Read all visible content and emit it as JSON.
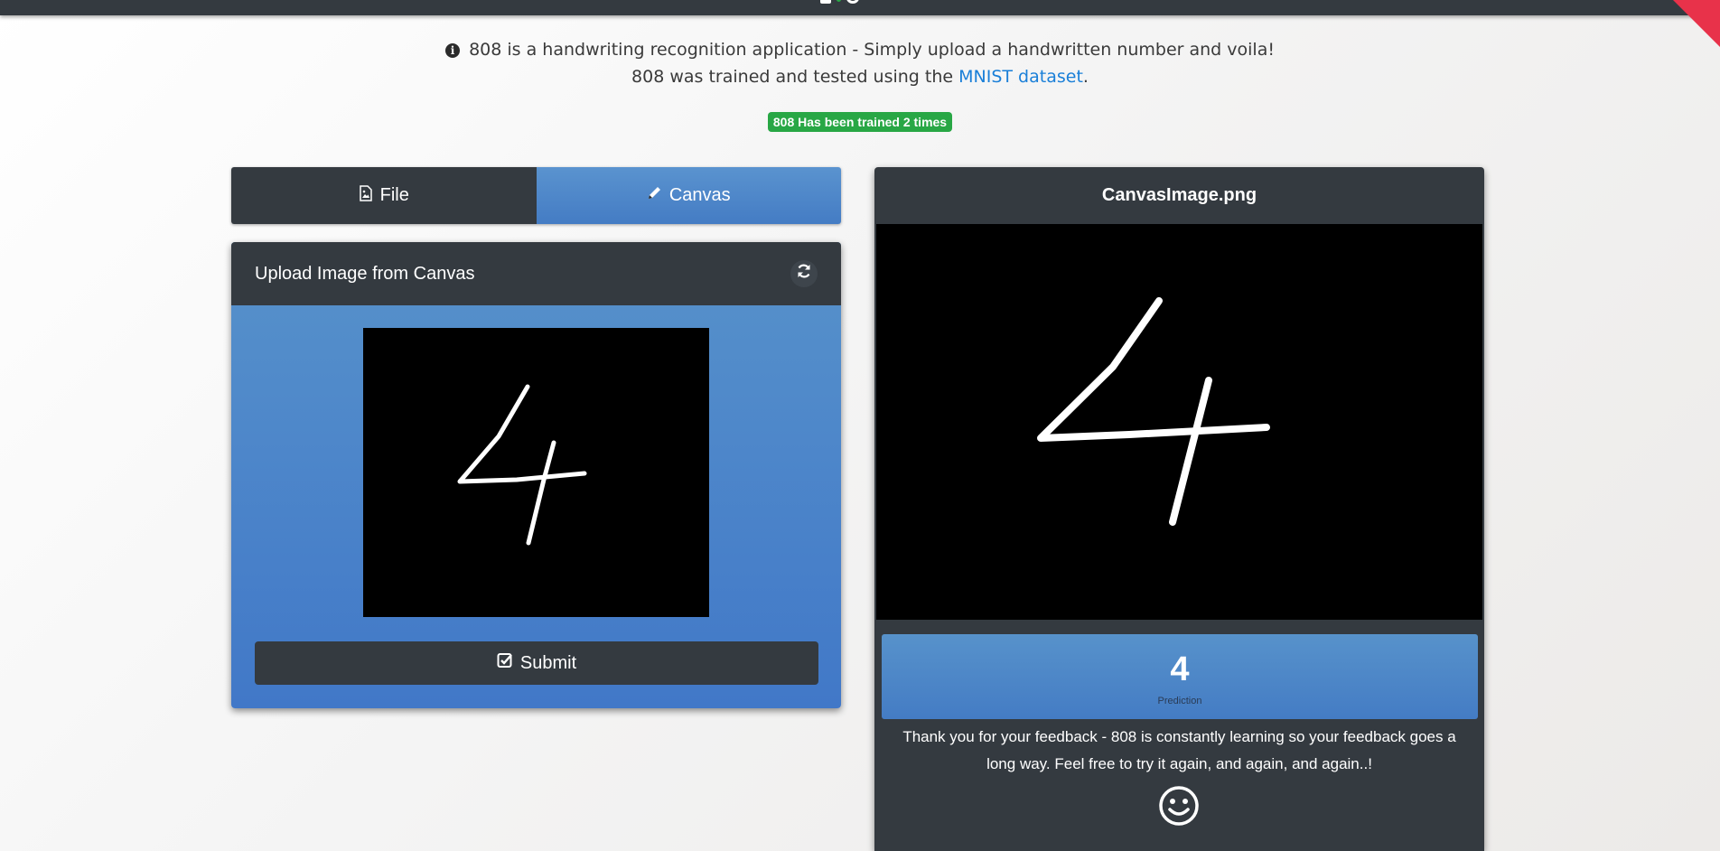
{
  "intro": {
    "line1": "808 is a handwriting recognition application - Simply upload a handwritten number and voila!",
    "line2_prefix": "808 was trained and tested using the",
    "line2_link": "MNIST dataset",
    "line2_suffix": "."
  },
  "badge": "808 Has been trained 2 times",
  "tabs": [
    {
      "label": "File",
      "icon": "image-file-icon",
      "active": false
    },
    {
      "label": "Canvas",
      "icon": "pencil-icon",
      "active": true
    }
  ],
  "upload": {
    "title": "Upload Image from Canvas",
    "refresh_icon": "refresh-icon",
    "submit_label": "Submit",
    "submit_icon": "checkbox-icon"
  },
  "result": {
    "filename": "CanvasImage.png",
    "prediction_value": "4",
    "prediction_label": "Prediction",
    "feedback": "Thank you for your feedback - 808 is constantly learning so your feedback goes a long way. Feel free to try it again, and again, and again..!",
    "feedback_icon": "smiley-icon"
  },
  "colors": {
    "navbar": "#343a40",
    "accent_blue": "#4a84c8",
    "badge_green": "#28a745",
    "link_blue": "#1a7fd8",
    "ribbon_red": "#e8324a"
  }
}
